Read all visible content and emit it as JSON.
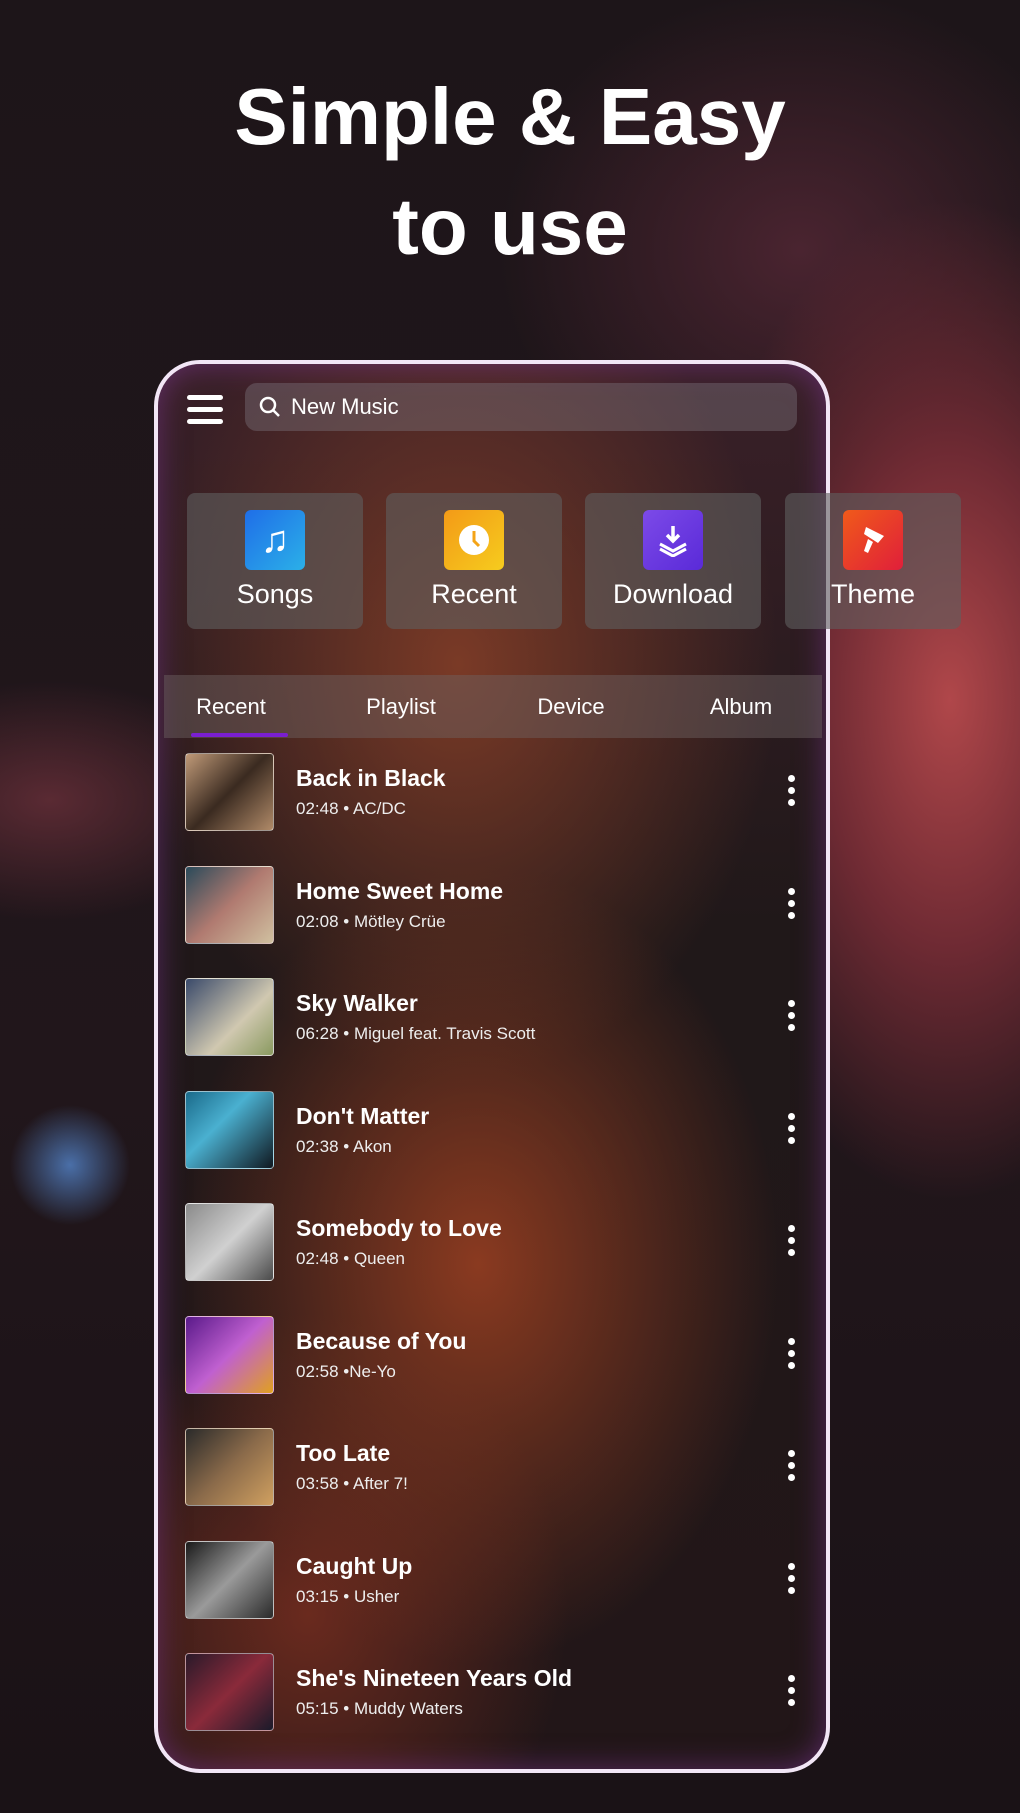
{
  "headline": {
    "line1": "Simple & Easy",
    "line2": "to use"
  },
  "search": {
    "placeholder": "New Music"
  },
  "tiles": [
    {
      "label": "Songs",
      "icon": "music-notes-icon",
      "color": "#1f8ae8"
    },
    {
      "label": "Recent",
      "icon": "clock-icon",
      "color": "#f4a417"
    },
    {
      "label": "Download",
      "icon": "download-icon",
      "color": "#6a3de0"
    },
    {
      "label": "Theme",
      "icon": "paint-brush-icon",
      "color": "#e8402a"
    }
  ],
  "tabs": [
    {
      "label": "Recent",
      "active": true
    },
    {
      "label": "Playlist"
    },
    {
      "label": "Device"
    },
    {
      "label": "Album"
    }
  ],
  "accent": "#7a1fd0",
  "songs": [
    {
      "title": "Back in Black",
      "sub": "02:48 • AC/DC"
    },
    {
      "title": "Home Sweet Home",
      "sub": "02:08 • Mötley Crüe"
    },
    {
      "title": "Sky Walker",
      "sub": "06:28 • Miguel feat. Travis Scott"
    },
    {
      "title": "Don't Matter",
      "sub": "02:38 • Akon"
    },
    {
      "title": "Somebody to Love",
      "sub": "02:48 • Queen"
    },
    {
      "title": "Because of You",
      "sub": "02:58 •Ne-Yo"
    },
    {
      "title": "Too Late",
      "sub": "03:58 • After 7!"
    },
    {
      "title": "Caught Up",
      "sub": "03:15 • Usher"
    },
    {
      "title": "She's Nineteen Years Old",
      "sub": "05:15 • Muddy Waters"
    }
  ]
}
